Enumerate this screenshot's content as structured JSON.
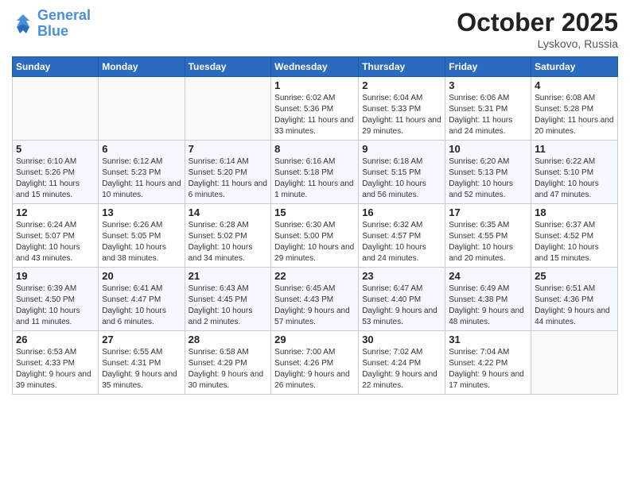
{
  "header": {
    "logo_line1": "General",
    "logo_line2": "Blue",
    "month": "October 2025",
    "location": "Lyskovo, Russia"
  },
  "weekdays": [
    "Sunday",
    "Monday",
    "Tuesday",
    "Wednesday",
    "Thursday",
    "Friday",
    "Saturday"
  ],
  "weeks": [
    [
      {
        "day": "",
        "info": ""
      },
      {
        "day": "",
        "info": ""
      },
      {
        "day": "",
        "info": ""
      },
      {
        "day": "1",
        "info": "Sunrise: 6:02 AM\nSunset: 5:36 PM\nDaylight: 11 hours\nand 33 minutes."
      },
      {
        "day": "2",
        "info": "Sunrise: 6:04 AM\nSunset: 5:33 PM\nDaylight: 11 hours\nand 29 minutes."
      },
      {
        "day": "3",
        "info": "Sunrise: 6:06 AM\nSunset: 5:31 PM\nDaylight: 11 hours\nand 24 minutes."
      },
      {
        "day": "4",
        "info": "Sunrise: 6:08 AM\nSunset: 5:28 PM\nDaylight: 11 hours\nand 20 minutes."
      }
    ],
    [
      {
        "day": "5",
        "info": "Sunrise: 6:10 AM\nSunset: 5:26 PM\nDaylight: 11 hours\nand 15 minutes."
      },
      {
        "day": "6",
        "info": "Sunrise: 6:12 AM\nSunset: 5:23 PM\nDaylight: 11 hours\nand 10 minutes."
      },
      {
        "day": "7",
        "info": "Sunrise: 6:14 AM\nSunset: 5:20 PM\nDaylight: 11 hours\nand 6 minutes."
      },
      {
        "day": "8",
        "info": "Sunrise: 6:16 AM\nSunset: 5:18 PM\nDaylight: 11 hours\nand 1 minute."
      },
      {
        "day": "9",
        "info": "Sunrise: 6:18 AM\nSunset: 5:15 PM\nDaylight: 10 hours\nand 56 minutes."
      },
      {
        "day": "10",
        "info": "Sunrise: 6:20 AM\nSunset: 5:13 PM\nDaylight: 10 hours\nand 52 minutes."
      },
      {
        "day": "11",
        "info": "Sunrise: 6:22 AM\nSunset: 5:10 PM\nDaylight: 10 hours\nand 47 minutes."
      }
    ],
    [
      {
        "day": "12",
        "info": "Sunrise: 6:24 AM\nSunset: 5:07 PM\nDaylight: 10 hours\nand 43 minutes."
      },
      {
        "day": "13",
        "info": "Sunrise: 6:26 AM\nSunset: 5:05 PM\nDaylight: 10 hours\nand 38 minutes."
      },
      {
        "day": "14",
        "info": "Sunrise: 6:28 AM\nSunset: 5:02 PM\nDaylight: 10 hours\nand 34 minutes."
      },
      {
        "day": "15",
        "info": "Sunrise: 6:30 AM\nSunset: 5:00 PM\nDaylight: 10 hours\nand 29 minutes."
      },
      {
        "day": "16",
        "info": "Sunrise: 6:32 AM\nSunset: 4:57 PM\nDaylight: 10 hours\nand 24 minutes."
      },
      {
        "day": "17",
        "info": "Sunrise: 6:35 AM\nSunset: 4:55 PM\nDaylight: 10 hours\nand 20 minutes."
      },
      {
        "day": "18",
        "info": "Sunrise: 6:37 AM\nSunset: 4:52 PM\nDaylight: 10 hours\nand 15 minutes."
      }
    ],
    [
      {
        "day": "19",
        "info": "Sunrise: 6:39 AM\nSunset: 4:50 PM\nDaylight: 10 hours\nand 11 minutes."
      },
      {
        "day": "20",
        "info": "Sunrise: 6:41 AM\nSunset: 4:47 PM\nDaylight: 10 hours\nand 6 minutes."
      },
      {
        "day": "21",
        "info": "Sunrise: 6:43 AM\nSunset: 4:45 PM\nDaylight: 10 hours\nand 2 minutes."
      },
      {
        "day": "22",
        "info": "Sunrise: 6:45 AM\nSunset: 4:43 PM\nDaylight: 9 hours\nand 57 minutes."
      },
      {
        "day": "23",
        "info": "Sunrise: 6:47 AM\nSunset: 4:40 PM\nDaylight: 9 hours\nand 53 minutes."
      },
      {
        "day": "24",
        "info": "Sunrise: 6:49 AM\nSunset: 4:38 PM\nDaylight: 9 hours\nand 48 minutes."
      },
      {
        "day": "25",
        "info": "Sunrise: 6:51 AM\nSunset: 4:36 PM\nDaylight: 9 hours\nand 44 minutes."
      }
    ],
    [
      {
        "day": "26",
        "info": "Sunrise: 6:53 AM\nSunset: 4:33 PM\nDaylight: 9 hours\nand 39 minutes."
      },
      {
        "day": "27",
        "info": "Sunrise: 6:55 AM\nSunset: 4:31 PM\nDaylight: 9 hours\nand 35 minutes."
      },
      {
        "day": "28",
        "info": "Sunrise: 6:58 AM\nSunset: 4:29 PM\nDaylight: 9 hours\nand 30 minutes."
      },
      {
        "day": "29",
        "info": "Sunrise: 7:00 AM\nSunset: 4:26 PM\nDaylight: 9 hours\nand 26 minutes."
      },
      {
        "day": "30",
        "info": "Sunrise: 7:02 AM\nSunset: 4:24 PM\nDaylight: 9 hours\nand 22 minutes."
      },
      {
        "day": "31",
        "info": "Sunrise: 7:04 AM\nSunset: 4:22 PM\nDaylight: 9 hours\nand 17 minutes."
      },
      {
        "day": "",
        "info": ""
      }
    ]
  ]
}
